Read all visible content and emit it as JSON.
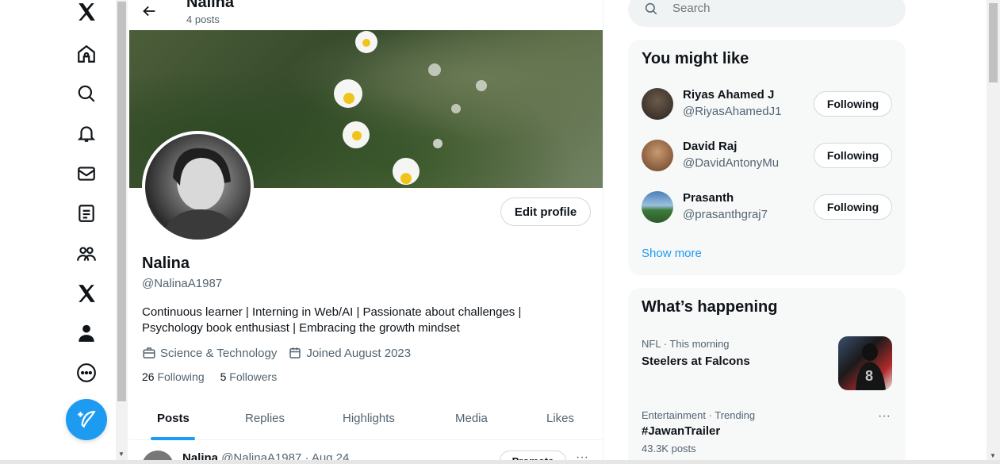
{
  "header": {
    "name": "Nalina",
    "post_count": "4 posts"
  },
  "profile": {
    "name": "Nalina",
    "handle": "@NalinaA1987",
    "bio_line1": "Continuous learner | Interning in Web/AI | Passionate about challenges |",
    "bio_line2": "Psychology book enthusiast | Embracing the growth mindset",
    "category": "Science & Technology",
    "joined": "Joined August 2023",
    "following_count": "26",
    "following_label": "Following",
    "followers_count": "5",
    "followers_label": "Followers",
    "edit_label": "Edit profile"
  },
  "tabs": [
    "Posts",
    "Replies",
    "Highlights",
    "Media",
    "Likes"
  ],
  "post": {
    "author": "Nalina",
    "meta": "@NalinaA1987 · Aug 24",
    "promote_label": "Promote",
    "more": "···"
  },
  "search": {
    "placeholder": "Search"
  },
  "you_might_like": {
    "title": "You might like",
    "users": [
      {
        "name": "Riyas Ahamed J",
        "handle": "@RiyasAhamedJ1",
        "button": "Following"
      },
      {
        "name": "David Raj",
        "handle": "@DavidAntonyMu",
        "button": "Following"
      },
      {
        "name": "Prasanth",
        "handle": "@prasanthgraj7",
        "button": "Following"
      }
    ],
    "show_more": "Show more"
  },
  "whats_happening": {
    "title": "What’s happening",
    "trends": [
      {
        "meta": "NFL · This morning",
        "title": "Steelers at Falcons",
        "sub": ""
      },
      {
        "meta": "Entertainment · Trending",
        "title": "#JawanTrailer",
        "sub": "43.3K posts"
      }
    ],
    "more": "···"
  },
  "colors": {
    "accent": "#1d9bf0",
    "text": "#0f1419",
    "muted": "#536471"
  }
}
